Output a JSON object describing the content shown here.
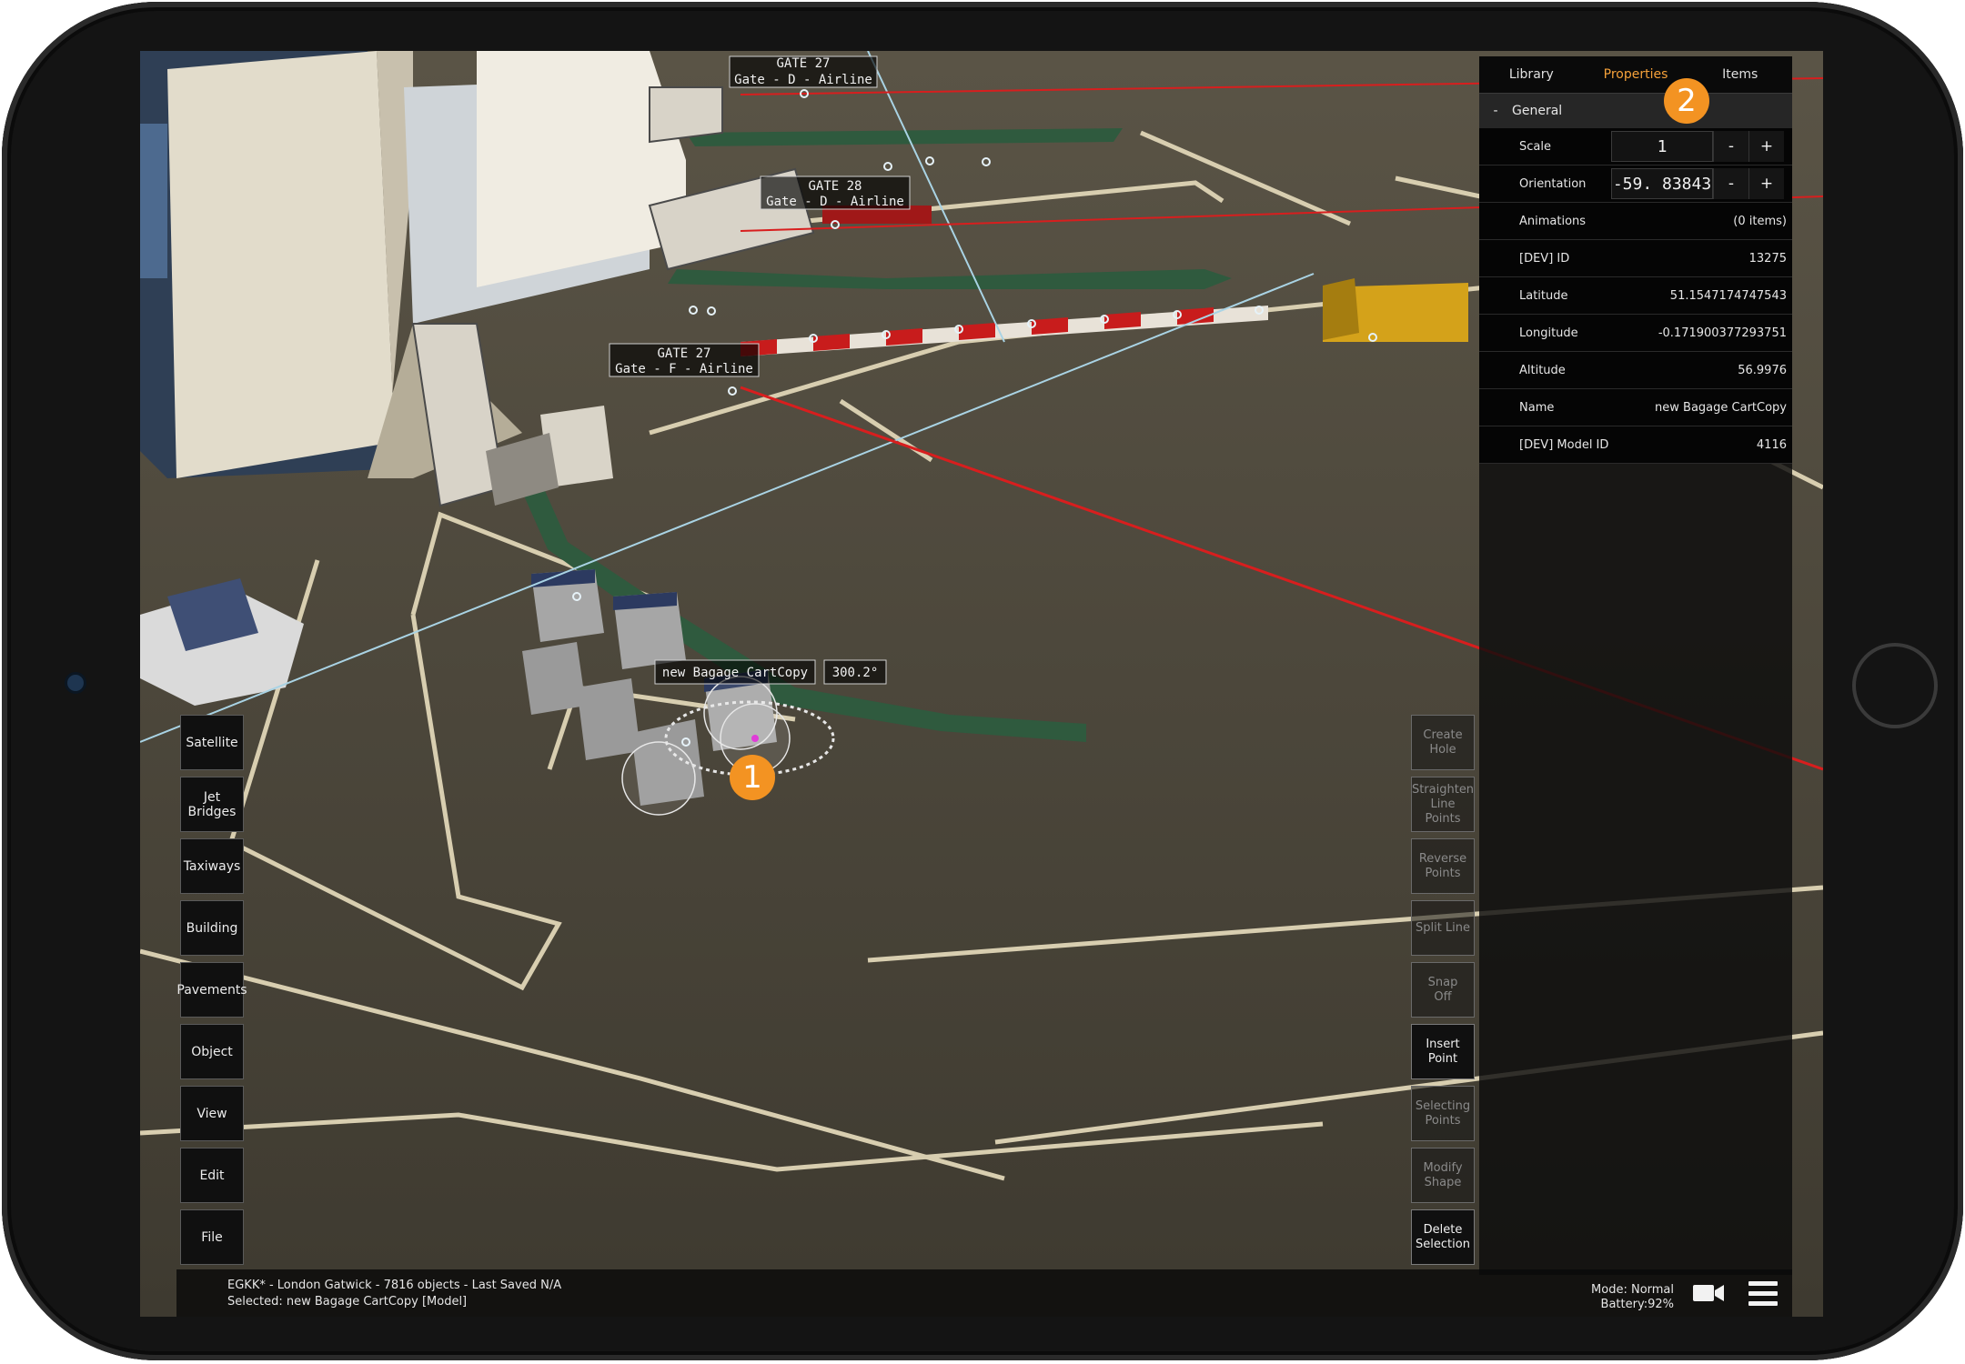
{
  "scene": {
    "gate_labels": [
      {
        "line1": "GATE 27",
        "line2": "Gate - D - Airline"
      },
      {
        "line1": "GATE 28",
        "line2": "Gate - D - Airline"
      },
      {
        "line1": "GATE 27",
        "line2": "Gate - F - Airline"
      }
    ],
    "selected_label": "new Bagage CartCopy",
    "selected_angle": "300.2°"
  },
  "left_menu": [
    "Satellite",
    "Jet\nBridges",
    "Taxiways",
    "Building",
    "Pavements",
    "Object",
    "View",
    "Edit",
    "File"
  ],
  "tools": [
    {
      "label": "Create\nHole",
      "active": false
    },
    {
      "label": "Straighten\nLine Points",
      "active": false
    },
    {
      "label": "Reverse\nPoints",
      "active": false
    },
    {
      "label": "Split Line",
      "active": false
    },
    {
      "label": "Snap\nOff",
      "active": false
    },
    {
      "label": "Insert\nPoint",
      "active": true
    },
    {
      "label": "Selecting\nPoints",
      "active": false
    },
    {
      "label": "Modify\nShape",
      "active": false
    },
    {
      "label": "Delete\nSelection",
      "active": true
    }
  ],
  "panel": {
    "tabs": [
      "Library",
      "Properties",
      "Items"
    ],
    "active_tab": "Properties",
    "section": {
      "toggle": "-",
      "title": "General"
    },
    "scale": {
      "label": "Scale",
      "value": "1",
      "minus": "-",
      "plus": "+"
    },
    "orientation": {
      "label": "Orientation",
      "value": "-59. 83843",
      "minus": "-",
      "plus": "+"
    },
    "rows": [
      {
        "label": "Animations",
        "value": "(0 items)"
      },
      {
        "label": "[DEV] ID",
        "value": "13275"
      },
      {
        "label": "Latitude",
        "value": "51.1547174747543"
      },
      {
        "label": "Longitude",
        "value": "-0.171900377293751"
      },
      {
        "label": "Altitude",
        "value": "56.9976"
      },
      {
        "label": "Name",
        "value": "new Bagage CartCopy"
      },
      {
        "label": "[DEV] Model ID",
        "value": "4116"
      }
    ]
  },
  "badges": {
    "one": "1",
    "two": "2"
  },
  "status": {
    "line1": "EGKK* - London Gatwick - 7816 objects - Last Saved N/A",
    "line2": "Selected: new Bagage CartCopy [Model]",
    "mode": "Mode: Normal",
    "battery": "Battery:92%"
  },
  "colors": {
    "accent": "#f39322",
    "active_tab": "#f5a13a",
    "ground": "#4a4538",
    "red_line": "#d81e1e",
    "taxi_green": "#2f5a3e"
  },
  "icons": [
    "video-camera-icon",
    "hamburger-menu-icon"
  ]
}
